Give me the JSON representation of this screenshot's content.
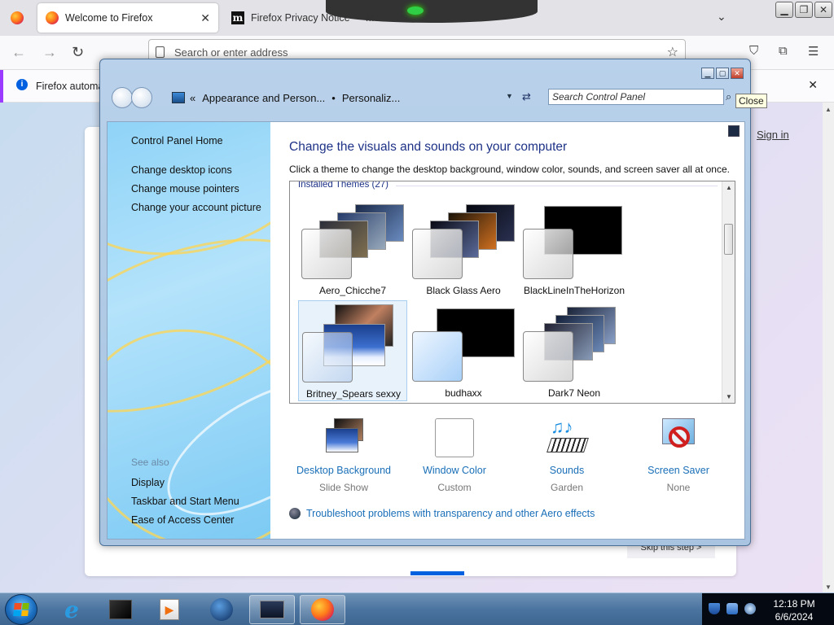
{
  "browser": {
    "tabs": [
      {
        "title": "Welcome to Firefox"
      },
      {
        "title": "Firefox Privacy Notice — Mo"
      }
    ],
    "address_placeholder": "Search or enter address",
    "notice": "Firefox automa",
    "sign_in": "Sign in",
    "skip_step": "Skip this step  >"
  },
  "control_panel": {
    "breadcrumb": [
      "Appearance and Person...",
      "Personaliz..."
    ],
    "search_placeholder": "Search Control Panel",
    "close_tooltip": "Close",
    "sidebar": {
      "links": [
        "Control Panel Home",
        "Change desktop icons",
        "Change mouse pointers",
        "Change your account picture"
      ],
      "see_also_label": "See also",
      "see_also": [
        "Display",
        "Taskbar and Start Menu",
        "Ease of Access Center"
      ]
    },
    "heading": "Change the visuals and sounds on your computer",
    "description": "Click a theme to change the desktop background, window color, sounds, and screen saver all at once.",
    "themes_group": "Installed Themes (27)",
    "themes": [
      {
        "name": "Aero_Chicche7"
      },
      {
        "name": "Black Glass Aero"
      },
      {
        "name": "BlackLineInTheHorizon"
      },
      {
        "name": "Britney_Spears sexxy"
      },
      {
        "name": "budhaxx"
      },
      {
        "name": "Dark7 Neon"
      }
    ],
    "settings": [
      {
        "label": "Desktop Background",
        "value": "Slide Show"
      },
      {
        "label": "Window Color",
        "value": "Custom"
      },
      {
        "label": "Sounds",
        "value": "Garden"
      },
      {
        "label": "Screen Saver",
        "value": "None"
      }
    ],
    "troubleshoot": "Troubleshoot problems with transparency and other Aero effects"
  },
  "taskbar": {
    "time": "12:18 PM",
    "date": "6/6/2024"
  },
  "colors": {
    "link": "#1a6fb8",
    "heading": "#1e3287",
    "taskbar": "#4b74a0"
  }
}
